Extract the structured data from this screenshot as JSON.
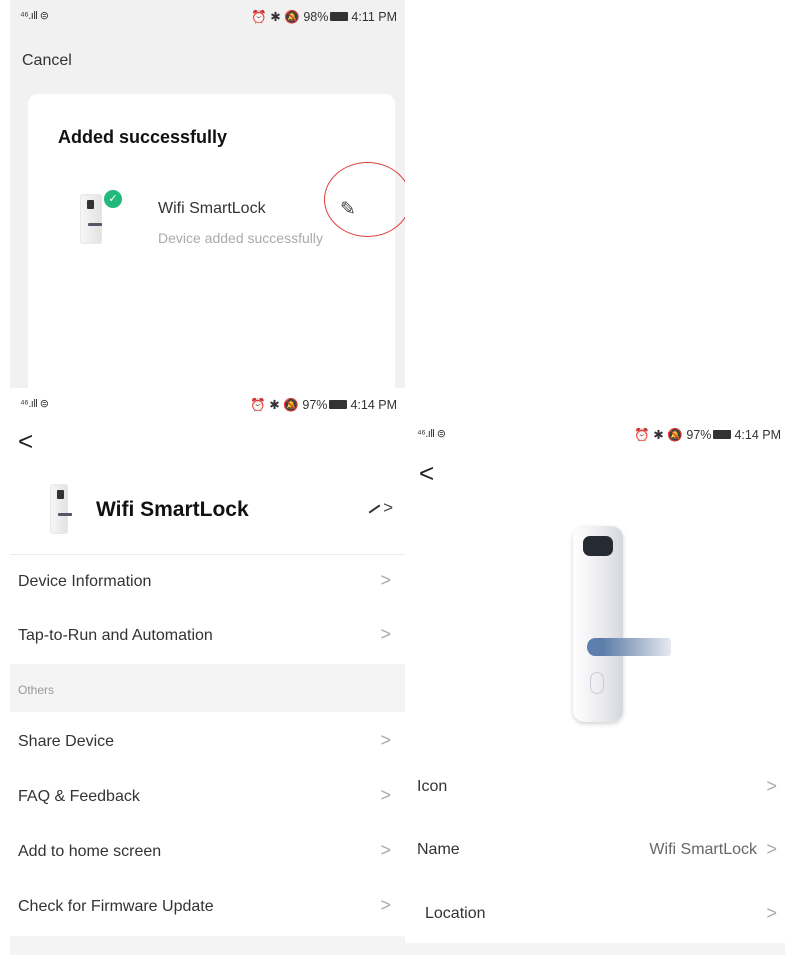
{
  "screen1": {
    "status": {
      "signal": "⁴⁶.ıll ⊜",
      "right_icons": "⏰ ✱ 🔕",
      "battery": "98%",
      "time": "4:11 PM"
    },
    "cancel_label": "Cancel",
    "card_title": "Added successfully",
    "device_name": "Wifi SmartLock",
    "device_status": "Device added successfully",
    "edit_icon": "pencil-icon",
    "annotation_color": "#e0403a"
  },
  "screen2": {
    "status": {
      "signal": "⁴⁶.ıll ⊜",
      "right_icons": "⏰ ✱ 🔕",
      "battery": "97%",
      "time": "4:14 PM"
    },
    "device_name": "Wifi SmartLock",
    "rows_top": [
      "Device Information",
      "Tap-to-Run and Automation"
    ],
    "section_title": "Others",
    "rows_bottom": [
      "Share Device",
      "FAQ & Feedback",
      "Add to home screen",
      "Check for Firmware Update"
    ]
  },
  "screen3": {
    "status": {
      "signal": "⁴⁶.ıll ⊜",
      "right_icons": "⏰ ✱ 🔕",
      "battery": "97%",
      "time": "4:14 PM"
    },
    "rows": [
      {
        "label": "Icon",
        "value": ""
      },
      {
        "label": "Name",
        "value": "Wifi SmartLock"
      },
      {
        "label": "Location",
        "value": ""
      }
    ]
  },
  "theme": {
    "accent_green": "#22b97a",
    "chevron": ">",
    "back": "<"
  }
}
